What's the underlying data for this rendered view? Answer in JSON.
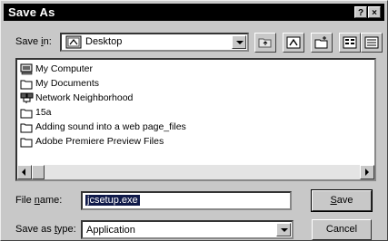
{
  "window": {
    "title": "Save As",
    "help_button": "?",
    "close_button": "×"
  },
  "save_in": {
    "label_prefix": "Save ",
    "label_accel": "i",
    "label_suffix": "n:",
    "value": "Desktop",
    "icon": "desktop-icon"
  },
  "toolbar": {
    "buttons": [
      "up-one-level-icon",
      "go-to-desktop-icon",
      "create-new-folder-icon",
      "list-view-icon",
      "details-view-icon"
    ]
  },
  "files": [
    {
      "name": "My Computer",
      "icon": "my-computer-icon"
    },
    {
      "name": "My Documents",
      "icon": "folder-icon"
    },
    {
      "name": "Network Neighborhood",
      "icon": "network-neighborhood-icon"
    },
    {
      "name": "15a",
      "icon": "folder-icon"
    },
    {
      "name": "Adding sound into a web page_files",
      "icon": "folder-icon"
    },
    {
      "name": "Adobe Premiere Preview Files",
      "icon": "folder-icon"
    }
  ],
  "file_name": {
    "label_prefix": "File ",
    "label_accel": "n",
    "label_suffix": "ame:",
    "value": "jcsetup.exe"
  },
  "save_as_type": {
    "label_prefix": "Save as ",
    "label_accel": "t",
    "label_suffix": "ype:",
    "value": "Application"
  },
  "buttons": {
    "save_accel": "S",
    "save_rest": "ave",
    "cancel": "Cancel"
  }
}
